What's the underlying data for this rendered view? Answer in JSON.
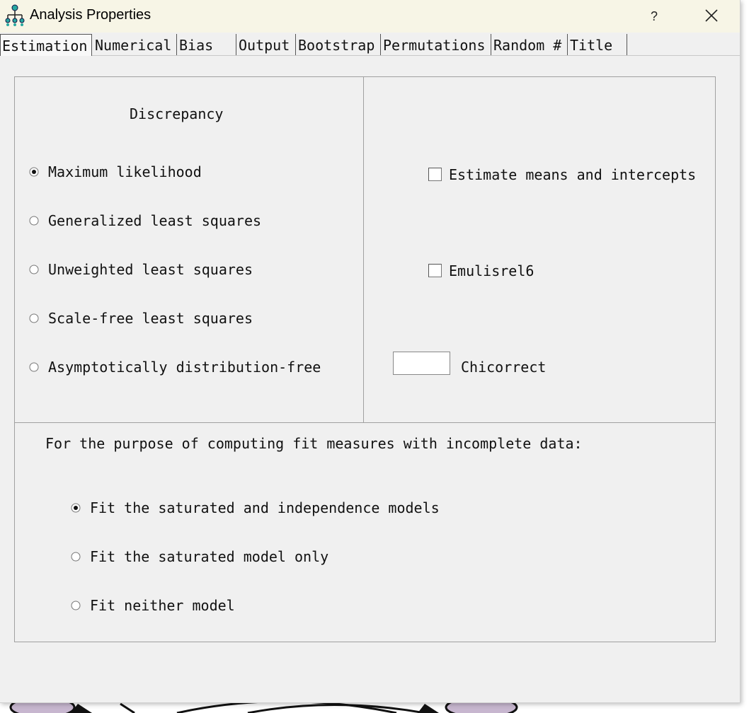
{
  "window": {
    "title": "Analysis Properties",
    "help_label": "?"
  },
  "tabs": [
    "Estimation",
    "Numerical",
    "Bias",
    "Output",
    "Bootstrap",
    "Permutations",
    "Random #",
    "Title"
  ],
  "discrepancy": {
    "heading": "Discrepancy",
    "options": [
      {
        "label": "Maximum likelihood",
        "selected": true
      },
      {
        "label": "Generalized least squares",
        "selected": false
      },
      {
        "label": "Unweighted least squares",
        "selected": false
      },
      {
        "label": "Scale-free least squares",
        "selected": false
      },
      {
        "label": "Asymptotically distribution-free",
        "selected": false
      }
    ]
  },
  "options_panel": {
    "estimate_means_label": "Estimate means and intercepts",
    "estimate_means_checked": false,
    "emulisrel_label": "Emulisrel6",
    "emulisrel_checked": false,
    "chicorrect_label": "Chicorrect",
    "chicorrect_value": ""
  },
  "incomplete": {
    "heading": "For the purpose of computing fit measures with incomplete data:",
    "options": [
      {
        "label": "Fit the saturated and independence models",
        "selected": true
      },
      {
        "label": "Fit the saturated model only",
        "selected": false
      },
      {
        "label": "Fit neither model",
        "selected": false
      }
    ]
  }
}
